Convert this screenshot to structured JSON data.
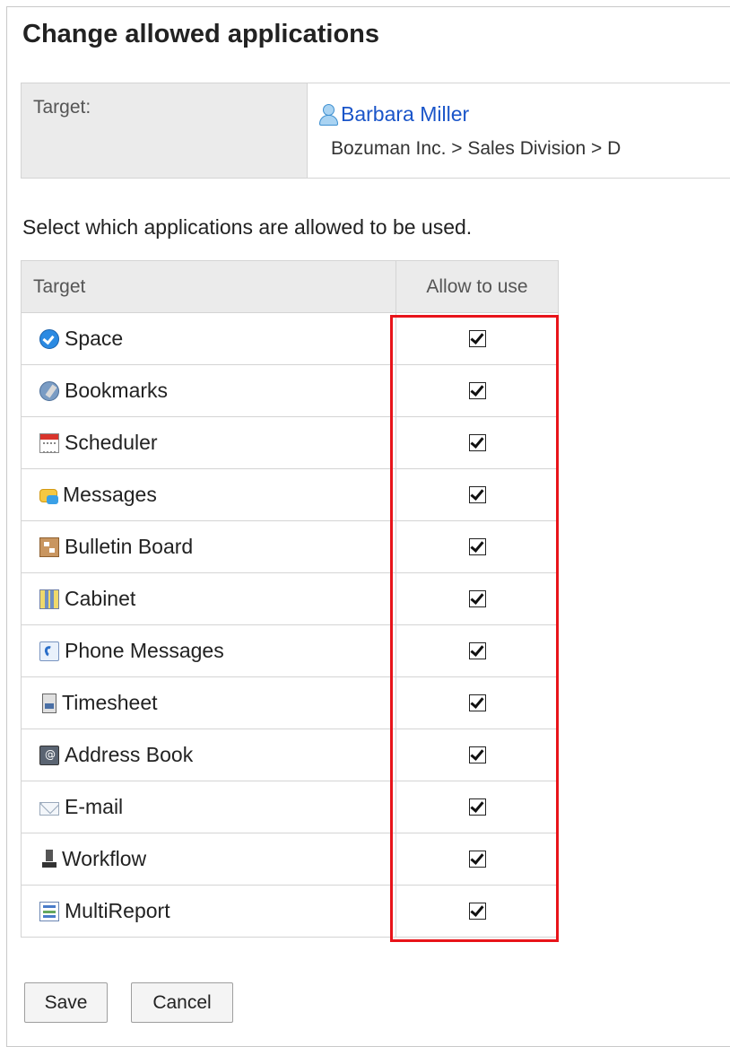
{
  "page": {
    "title": "Change allowed applications",
    "instruction": "Select which applications are allowed to be used."
  },
  "target": {
    "label": "Target:",
    "user_icon": "user-icon",
    "user_name": "Barbara Miller",
    "org_path": "Bozuman Inc. > Sales Division > D"
  },
  "table": {
    "headers": {
      "target": "Target",
      "allow": "Allow to use"
    },
    "rows": [
      {
        "name": "Space",
        "icon": "space-icon",
        "allowed": true
      },
      {
        "name": "Bookmarks",
        "icon": "bookmarks-icon",
        "allowed": true
      },
      {
        "name": "Scheduler",
        "icon": "scheduler-icon",
        "allowed": true
      },
      {
        "name": "Messages",
        "icon": "messages-icon",
        "allowed": true
      },
      {
        "name": "Bulletin Board",
        "icon": "bulletin-board-icon",
        "allowed": true
      },
      {
        "name": "Cabinet",
        "icon": "cabinet-icon",
        "allowed": true
      },
      {
        "name": "Phone Messages",
        "icon": "phone-messages-icon",
        "allowed": true
      },
      {
        "name": "Timesheet",
        "icon": "timesheet-icon",
        "allowed": true
      },
      {
        "name": "Address Book",
        "icon": "address-book-icon",
        "allowed": true
      },
      {
        "name": "E-mail",
        "icon": "email-icon",
        "allowed": true
      },
      {
        "name": "Workflow",
        "icon": "workflow-icon",
        "allowed": true
      },
      {
        "name": "MultiReport",
        "icon": "multireport-icon",
        "allowed": true
      }
    ]
  },
  "buttons": {
    "save": "Save",
    "cancel": "Cancel"
  },
  "colors": {
    "link": "#1a55c9",
    "highlight": "#e8141a",
    "header_bg": "#ebebeb"
  }
}
